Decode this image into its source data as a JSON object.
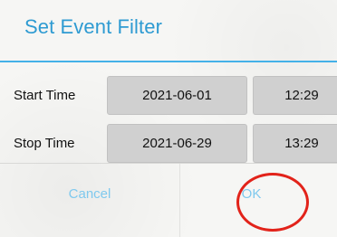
{
  "dialog": {
    "title": "Set Event Filter",
    "accent_color": "#2e9bd2",
    "rows": [
      {
        "label": "Start Time",
        "date": "2021-06-01",
        "time": "12:29"
      },
      {
        "label": "Stop Time",
        "date": "2021-06-29",
        "time": "13:29"
      }
    ],
    "buttons": {
      "cancel_label": "Cancel",
      "ok_label": "OK"
    }
  },
  "annotation": {
    "color": "#e2231a",
    "target": "ok-button"
  }
}
